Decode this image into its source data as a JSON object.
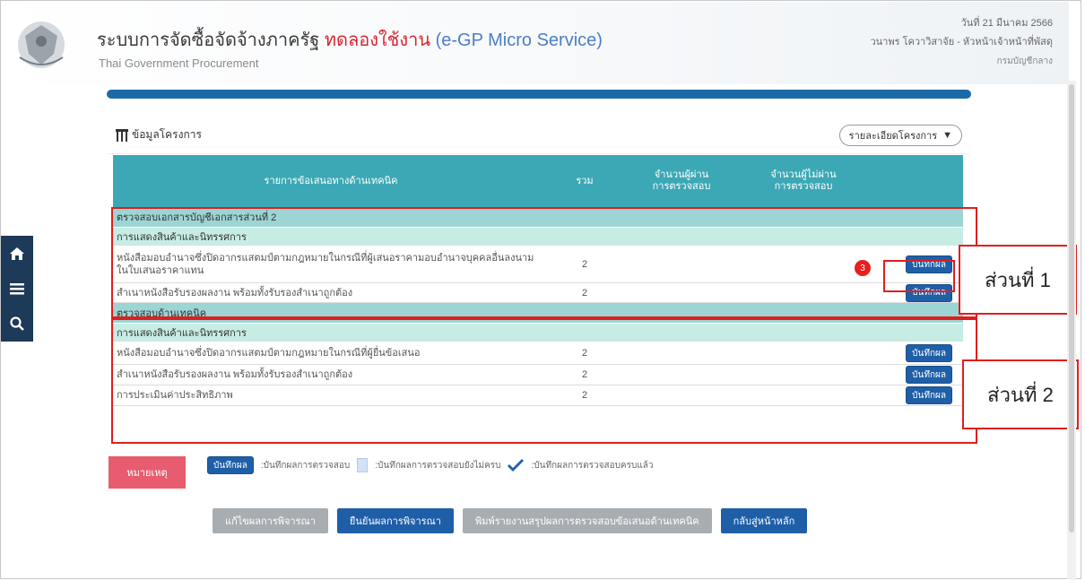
{
  "header": {
    "title_prefix": "ระบบการจัดซื้อจัดจ้างภาครัฐ",
    "title_test": "ทดลองใช้งาน",
    "title_service": "(e-GP Micro Service)",
    "subtitle": "Thai Government Procurement",
    "date": "วันที่ 21 มีนาคม 2566",
    "user": "วนาพร โควาวิสาจัย - หัวหน้าเจ้าหน้าที่พัสดุ",
    "department": "กรมบัญชีกลาง"
  },
  "card": {
    "title": "ข้อมูลโครงการ",
    "detail_button": "รายละเอียดโครงการ"
  },
  "table": {
    "headers": [
      "รายการข้อเสนอทางด้านเทคนิค",
      "รวม",
      "จำนวนผู้ผ่าน\nการตรวจสอบ",
      "จำนวนผู้ไม่ผ่าน\nการตรวจสอบ",
      ""
    ],
    "sections": [
      {
        "title": "ตรวจสอบเอกสารบัญชีเอกสารส่วนที่ 2",
        "subtitle": "การแสดงสินค้าและนิทรรศการ",
        "rows": [
          {
            "label": "หนังสือมอบอำนาจซึ่งปิดอากรแสตมป์ตามกฎหมายในกรณีที่ผู้เสนอราคามอบอำนาจบุคคลอื่นลงนามในใบเสนอราคาแทน",
            "total": "2",
            "pass": "",
            "fail": "",
            "action": "บันทึกผล"
          },
          {
            "label": "สำเนาหนังสือรับรองผลงาน พร้อมทั้งรับรองสำเนาถูกต้อง",
            "total": "2",
            "pass": "",
            "fail": "",
            "action": "บันทึกผล"
          }
        ]
      },
      {
        "title": "ตรวจสอบด้านเทคนิค",
        "subtitle": "การแสดงสินค้าและนิทรรศการ",
        "rows": [
          {
            "label": "หนังสือมอบอำนาจซึ่งปิดอากรแสตมป์ตามกฎหมายในกรณีที่ผู้ยื่นข้อเสนอ",
            "total": "2",
            "pass": "",
            "fail": "",
            "action": "บันทึกผล"
          },
          {
            "label": "สำเนาหนังสือรับรองผลงาน พร้อมทั้งรับรองสำเนาถูกต้อง",
            "total": "2",
            "pass": "",
            "fail": "",
            "action": "บันทึกผล"
          },
          {
            "label": "การประเมินค่าประสิทธิภาพ",
            "total": "2",
            "pass": "",
            "fail": "",
            "action": "บันทึกผล"
          }
        ]
      }
    ]
  },
  "annotations": {
    "part1": "ส่วนที่ 1",
    "part2": "ส่วนที่ 2",
    "step": "3"
  },
  "legend": {
    "note_label": "หมายเหตุ",
    "save_sample": "บันทึกผล",
    "save_desc": ":บันทึกผลการตรวจสอบ",
    "incomplete_desc": ":บันทึกผลการตรวจสอบยังไม่ครบ",
    "complete_desc": ":บันทึกผลการตรวจสอบครบแล้ว"
  },
  "buttons": {
    "edit": "แก้ไขผลการพิจารณา",
    "confirm": "ยืนยันผลการพิจารณา",
    "print": "พิมพ์รายงานสรุปผลการตรวจสอบข้อเสนอด้านเทคนิค",
    "home": "กลับสู่หน้าหลัก"
  },
  "colors": {
    "table_header": "#3da8b5",
    "section_bg": "#9cd5d4",
    "subsection_bg": "#c7ece3",
    "primary_button": "#1f5fa8",
    "annotation_red": "#e01e1e"
  }
}
